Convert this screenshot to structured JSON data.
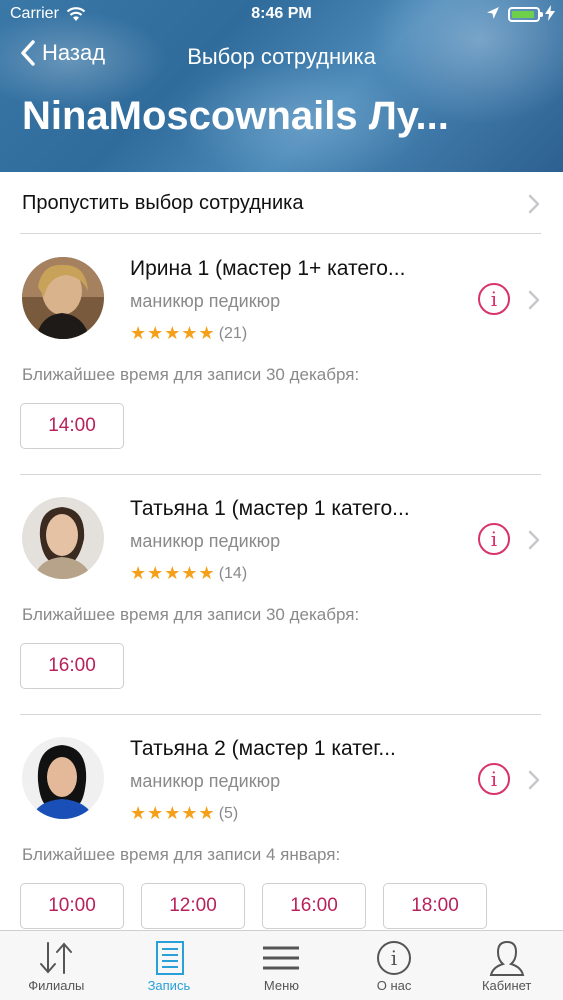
{
  "status_bar": {
    "carrier": "Carrier",
    "time": "8:46 PM"
  },
  "header": {
    "back_label": "Назад",
    "nav_title": "Выбор сотрудника",
    "title": "NinaMoscownails Лу..."
  },
  "skip": {
    "label": "Пропустить выбор сотрудника"
  },
  "staff": [
    {
      "name": "Ирина 1 (мастер 1+ катего...",
      "services": "маникюр педикюр",
      "stars": "★★★★★",
      "reviews": "(21)",
      "nearest": "Ближайшее время для записи 30 декабря:",
      "slots": [
        "14:00"
      ]
    },
    {
      "name": "Татьяна 1 (мастер 1 катего...",
      "services": "маникюр педикюр",
      "stars": "★★★★★",
      "reviews": "(14)",
      "nearest": "Ближайшее время для записи 30 декабря:",
      "slots": [
        "16:00"
      ]
    },
    {
      "name": "Татьяна 2 (мастер 1 катег...",
      "services": "маникюр педикюр",
      "stars": "★★★★★",
      "reviews": "(5)",
      "nearest": "Ближайшее время для записи 4 января:",
      "slots": [
        "10:00",
        "12:00",
        "16:00",
        "18:00"
      ]
    }
  ],
  "info_glyph": "i",
  "tabbar": {
    "items": [
      {
        "label": "Филиалы",
        "icon": "branches-arrows-icon",
        "active": false
      },
      {
        "label": "Запись",
        "icon": "booking-document-icon",
        "active": true
      },
      {
        "label": "Меню",
        "icon": "menu-lines-icon",
        "active": false
      },
      {
        "label": "О нас",
        "icon": "info-icon",
        "active": false
      },
      {
        "label": "Кабинет",
        "icon": "profile-icon",
        "active": false
      }
    ]
  },
  "colors": {
    "accent": "#d8336b",
    "slot_text": "#b8225a",
    "star": "#f5a01a",
    "tab_active": "#2aa0d8"
  }
}
